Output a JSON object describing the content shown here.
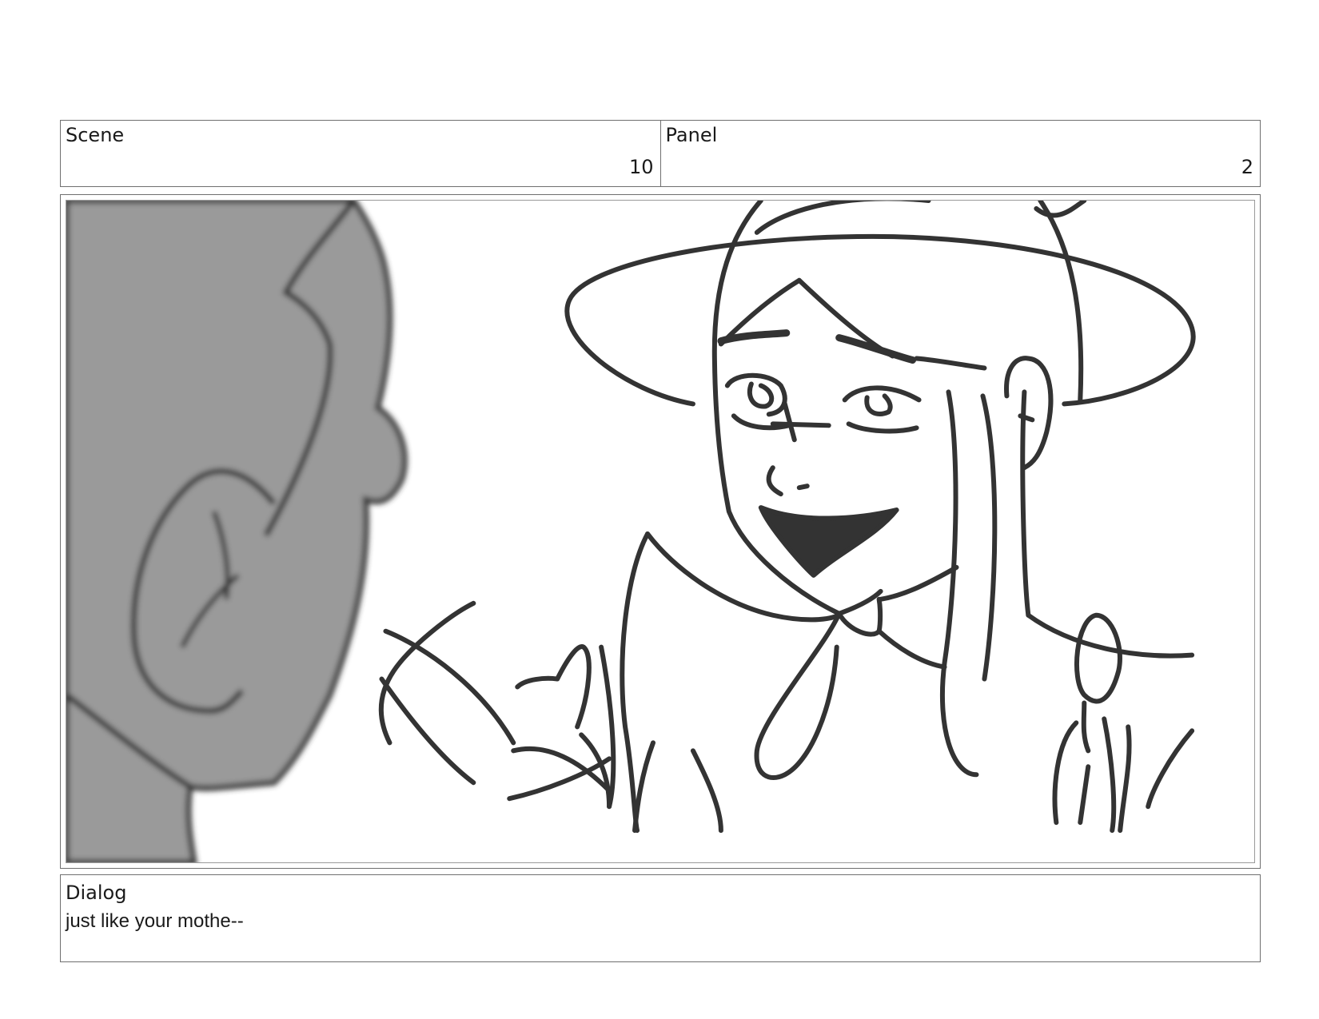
{
  "header": {
    "scene_label": "Scene",
    "scene_number": "10",
    "panel_label": "Panel",
    "panel_number": "2"
  },
  "frame": {
    "image_name": "storyboard-sketch",
    "colors": {
      "line": "#333333",
      "foreground_head": "#9a9a9a",
      "border": "#6f6f6f"
    }
  },
  "dialog": {
    "label": "Dialog",
    "text": "just like your mothe--"
  }
}
